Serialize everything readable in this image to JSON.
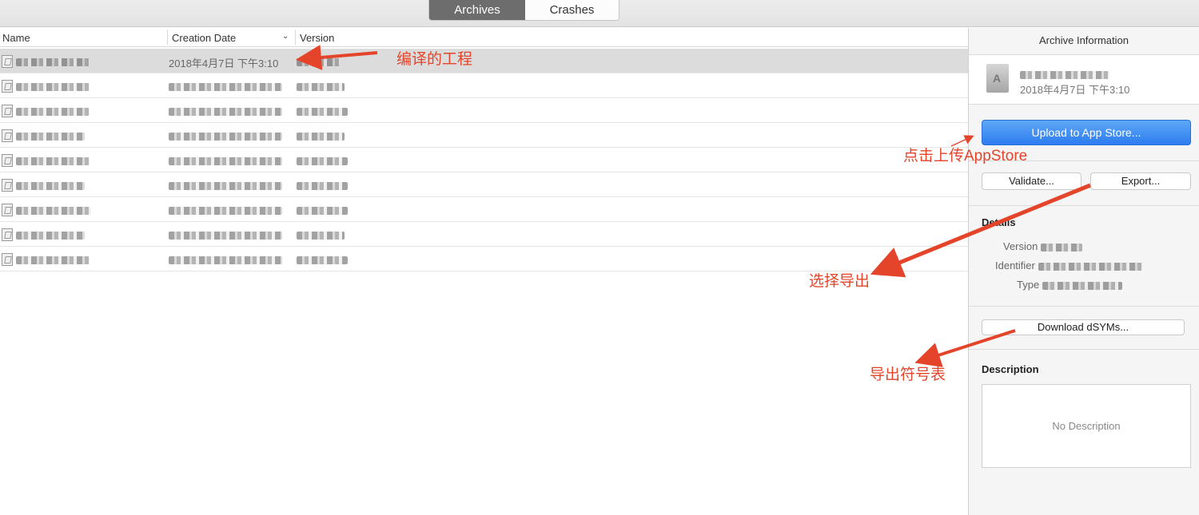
{
  "toolbar": {
    "tabs": [
      {
        "label": "Archives",
        "selected": true
      },
      {
        "label": "Crashes",
        "selected": false
      }
    ]
  },
  "list": {
    "columns": {
      "name": "Name",
      "creation_date": "Creation Date",
      "version": "Version"
    },
    "sort_icon": "chevron-down-icon",
    "rows": [
      {
        "date": "2018年4月7日 下午3:10"
      }
    ]
  },
  "inspector": {
    "title": "Archive Information",
    "archive_date": "2018年4月7日 下午3:10",
    "upload_button": "Upload to App Store...",
    "validate_button": "Validate...",
    "export_button": "Export...",
    "details_title": "Details",
    "details": {
      "version_label": "Version",
      "identifier_label": "Identifier",
      "type_label": "Type"
    },
    "download_dsyms_button": "Download dSYMs...",
    "description_title": "Description",
    "description_placeholder": "No Description"
  },
  "annotations": {
    "compiled_project": "编译的工程",
    "click_upload": "点击上传AppStore",
    "choose_export": "选择导出",
    "export_symbols": "导出符号表"
  },
  "colors": {
    "annotation": "#e4452a",
    "primary_button": "#2d7cf0",
    "selected_tab": "#6d6d6d"
  }
}
